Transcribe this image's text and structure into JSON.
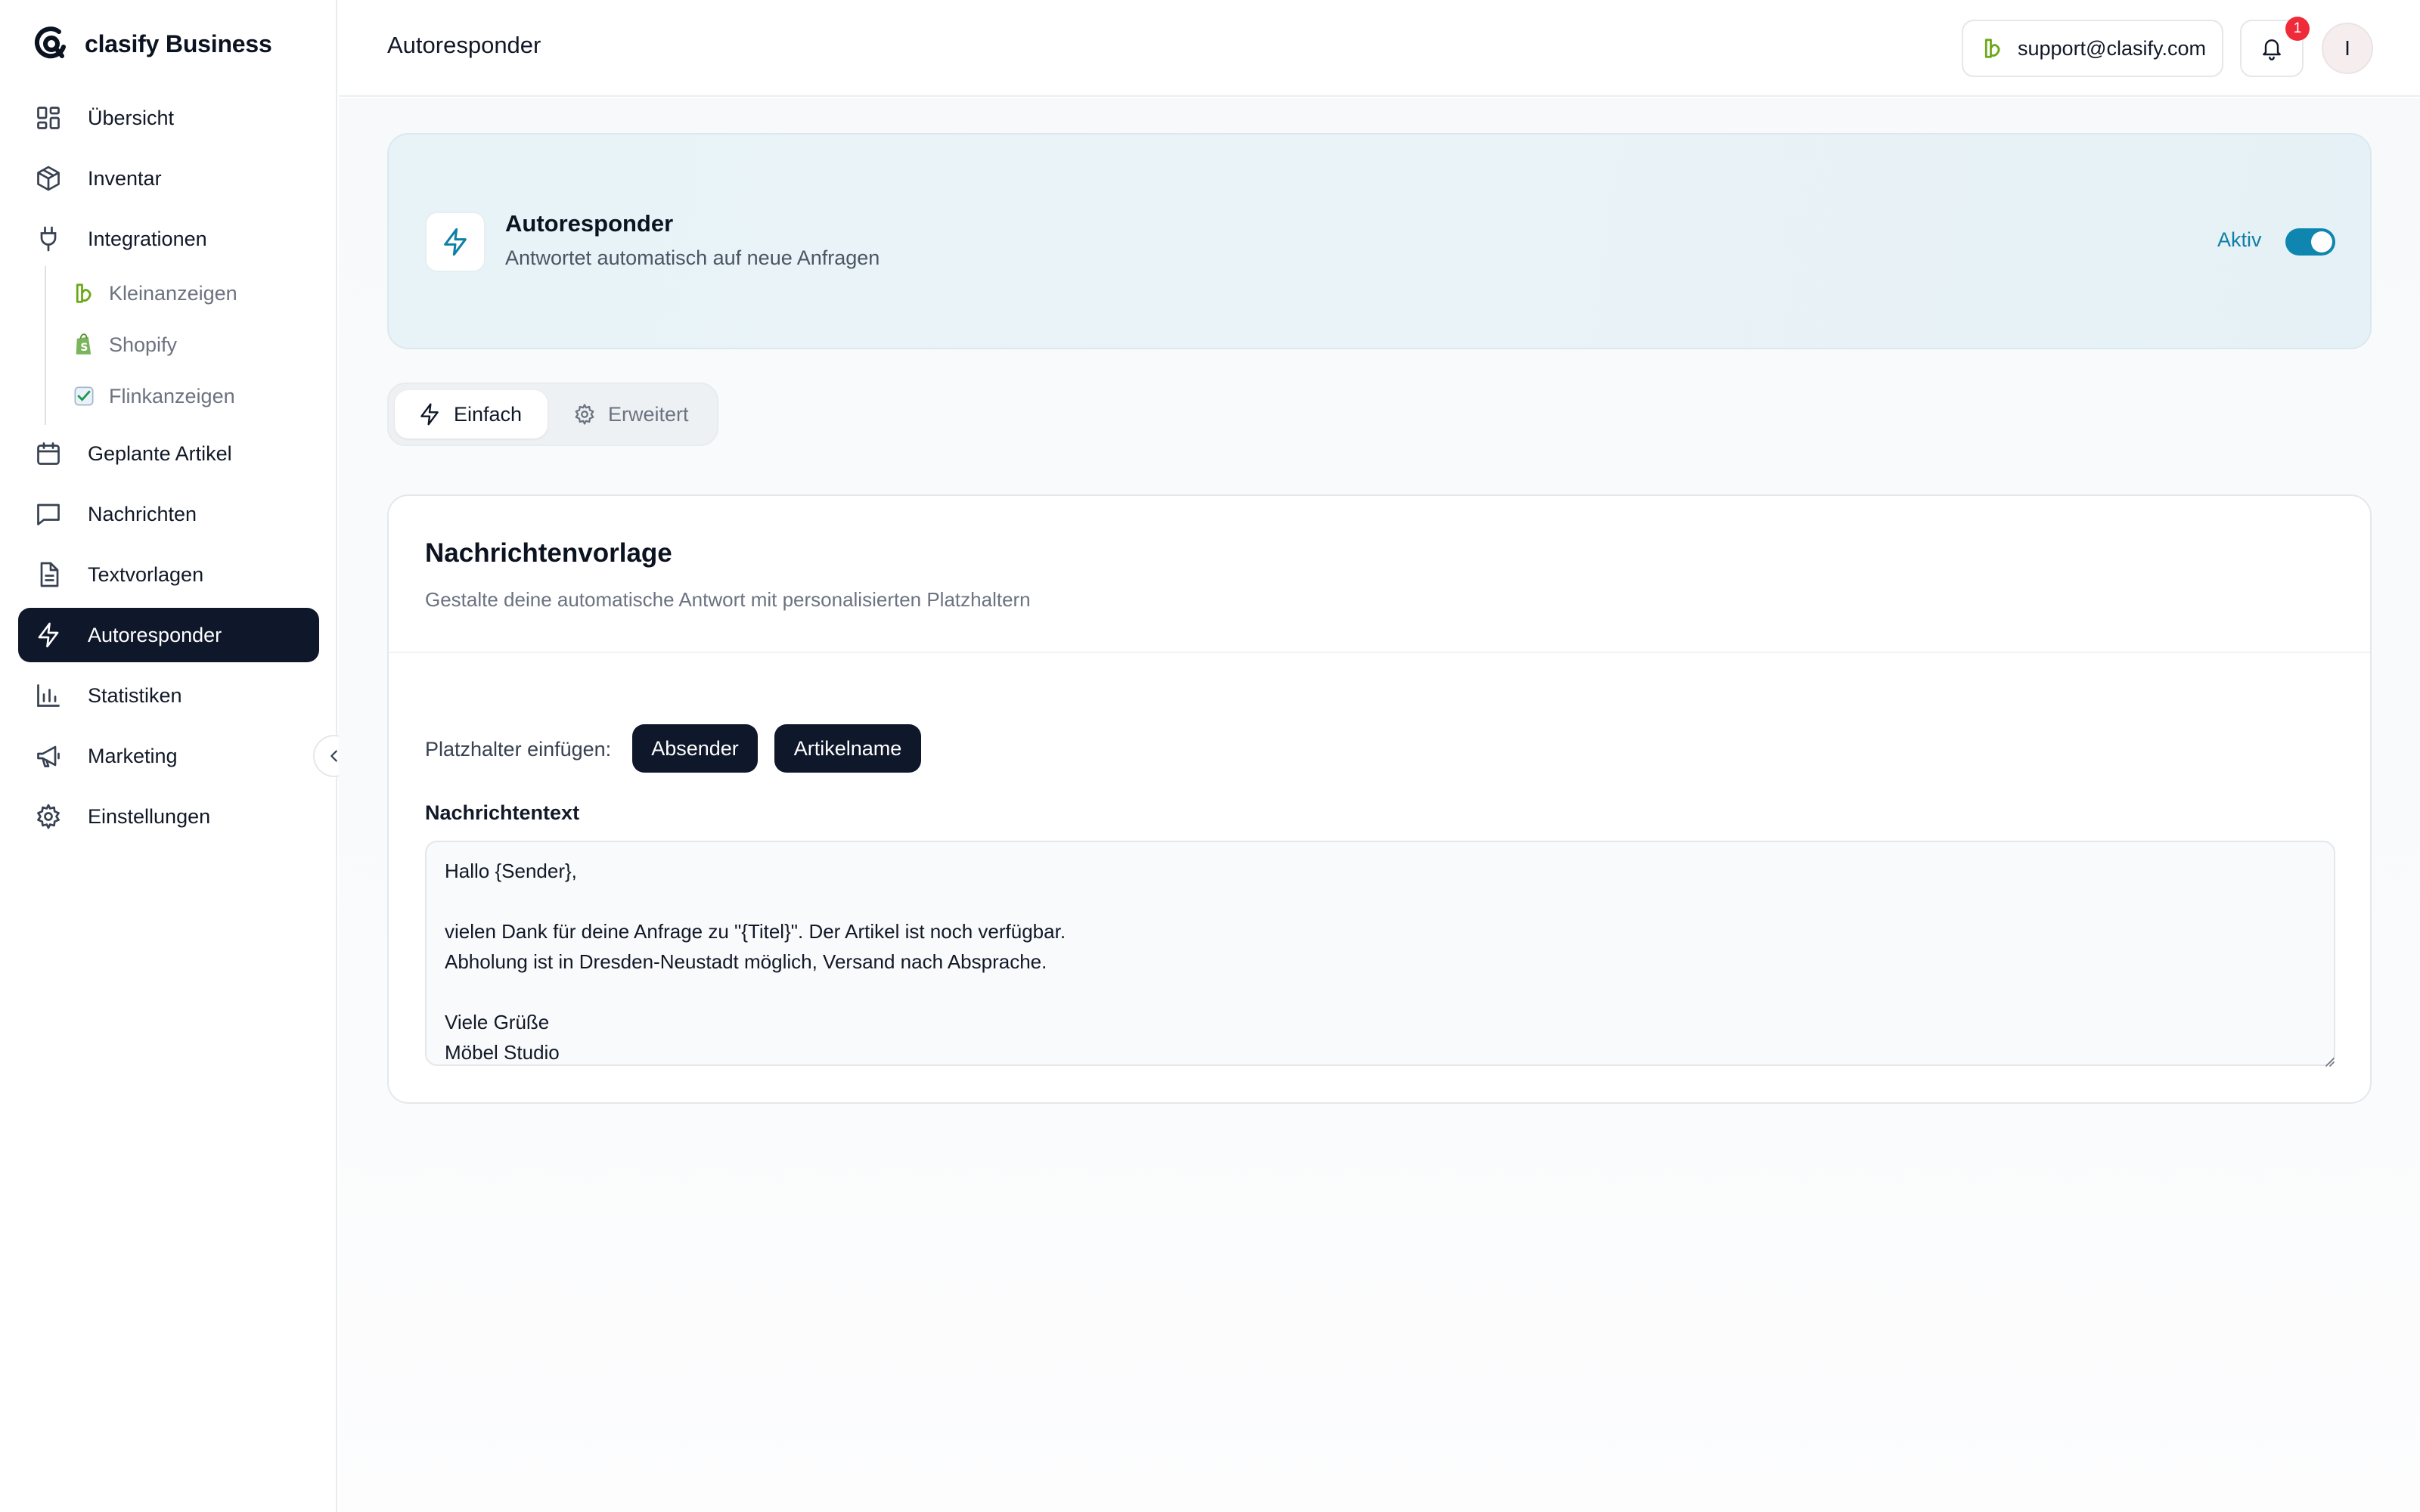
{
  "brand": {
    "name": "clasify Business"
  },
  "sidebar": {
    "items": [
      {
        "label": "Übersicht",
        "icon": "dashboard-icon"
      },
      {
        "label": "Inventar",
        "icon": "box-icon"
      },
      {
        "label": "Integrationen",
        "icon": "plug-icon"
      },
      {
        "label": "Geplante Artikel",
        "icon": "calendar-icon"
      },
      {
        "label": "Nachrichten",
        "icon": "message-icon"
      },
      {
        "label": "Textvorlagen",
        "icon": "document-icon"
      },
      {
        "label": "Autoresponder",
        "icon": "bolt-icon",
        "active": true
      },
      {
        "label": "Statistiken",
        "icon": "bar-chart-icon"
      },
      {
        "label": "Marketing",
        "icon": "megaphone-icon"
      },
      {
        "label": "Einstellungen",
        "icon": "gear-icon"
      }
    ],
    "sub_items": [
      {
        "label": "Kleinanzeigen",
        "icon": "kleinanzeigen-icon"
      },
      {
        "label": "Shopify",
        "icon": "shopify-icon"
      },
      {
        "label": "Flinkanzeigen",
        "icon": "flinkanzeigen-icon"
      }
    ]
  },
  "header": {
    "title": "Autoresponder",
    "support_email": "support@clasify.com",
    "notification_count": "1",
    "avatar_initial": "I"
  },
  "hero": {
    "title": "Autoresponder",
    "subtitle": "Antwortet automatisch auf neue Anfragen",
    "status_label": "Aktiv",
    "enabled": true
  },
  "tabs": [
    {
      "label": "Einfach",
      "active": true
    },
    {
      "label": "Erweitert",
      "active": false
    }
  ],
  "template_card": {
    "title": "Nachrichtenvorlage",
    "subtitle": "Gestalte deine automatische Antwort mit personalisierten Platzhaltern",
    "placeholder_label": "Platzhalter einfügen:",
    "placeholders": [
      "Absender",
      "Artikelname"
    ],
    "message_label": "Nachrichtentext",
    "message_text": "Hallo {Sender},\n\nvielen Dank für deine Anfrage zu \"{Titel}\". Der Artikel ist noch verfügbar.\nAbholung ist in Dresden-Neustadt möglich, Versand nach Absprache.\n\nViele Grüße\nMöbel Studio"
  },
  "colors": {
    "accent": "#0f86b0",
    "sidebar_active_bg": "#0f172a",
    "badge": "#ef2b3a",
    "kleinanzeigen_green": "#6aa818",
    "shopify_green": "#7ab55c"
  }
}
